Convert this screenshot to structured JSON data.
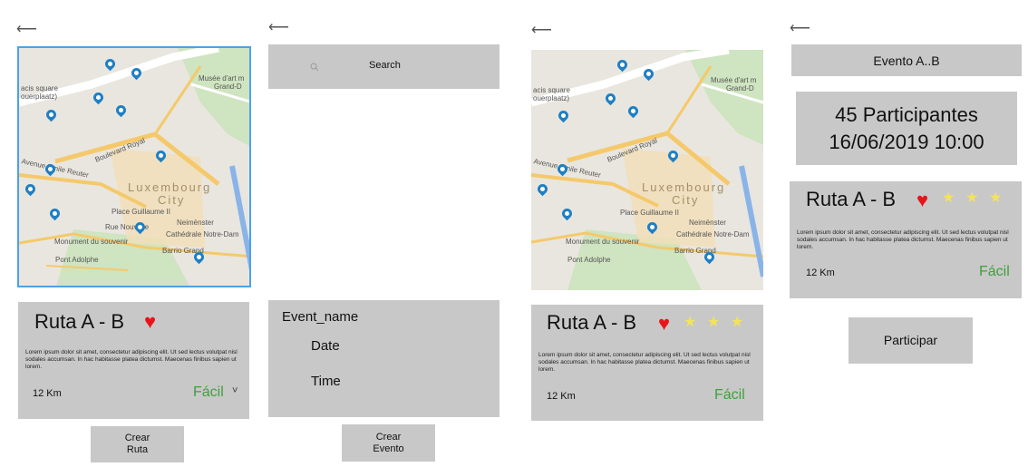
{
  "back_symbol": "⟵",
  "map_labels": {
    "square": "acis square",
    "square2": "ouerplaatz)",
    "museum": "Musée d'art m",
    "museum2": "Grand-D",
    "trois_glands": "rue des Trois Glands",
    "boulevard": "Boulevard Royal",
    "reuter": "Avenue Emile Reuter",
    "city": "Luxembourg",
    "city2": "City",
    "place_guillaume": "Place Guillaume II",
    "neimenster": "Neimënster",
    "notre_dame": "Cathédrale Notre-Dam",
    "monument": "Monument du souvenir",
    "barrio": "Barrio Grand",
    "pont": "Pont Adolphe",
    "nouvelle": "Rue Nouvelle",
    "monterey": "Avenue Monterey"
  },
  "screen1": {
    "title": "Ruta A - B",
    "description": "Lorem ipsum dolor sit amet, consectetur adipiscing elit. Ut sed lectus volutpat nisl sodales accumsan. In hac habitasse platea dictumst. Maecenas finibus sapien ut lorem.",
    "distance": "12 Km",
    "difficulty": "Fácil",
    "chevron": "˅",
    "button_line1": "Crear",
    "button_line2": "Ruta"
  },
  "screen2": {
    "search_placeholder": "Search",
    "event_name": "Event_name",
    "date": "Date",
    "time": "Time",
    "button_line1": "Crear",
    "button_line2": "Evento"
  },
  "screen3": {
    "title": "Ruta A - B",
    "description": "Lorem ipsum dolor sit amet, consectetur adipiscing elit. Ut sed lectus volutpat nisl sodales accumsan. In hac habitasse platea dictumst. Maecenas finibus sapien ut lorem.",
    "distance": "12 Km",
    "difficulty": "Fácil",
    "rating": 3
  },
  "screen4": {
    "event_title": "Evento A..B",
    "participants": "45 Participantes",
    "datetime": "16/06/2019 10:00",
    "title": "Ruta A - B",
    "description": "Lorem ipsum dolor sit amet, consectetur adipiscing elit. Ut sed lectus volutpat nisl sodales accumsan. In hac habitasse platea dictumst. Maecenas finibus sapien ut lorem.",
    "distance": "12 Km",
    "difficulty": "Fácil",
    "rating": 3,
    "button": "Participar"
  },
  "colors": {
    "pin": "#1f7fc4",
    "heart": "#e8141a",
    "star": "#f4e35a",
    "easy": "#3ea13e",
    "panel": "#c8c8c8",
    "map_border": "#4aa3e8"
  },
  "icons": [
    "back-arrow-icon",
    "map-pin-icon",
    "heart-icon",
    "star-icon",
    "search-icon",
    "chevron-down-icon"
  ]
}
